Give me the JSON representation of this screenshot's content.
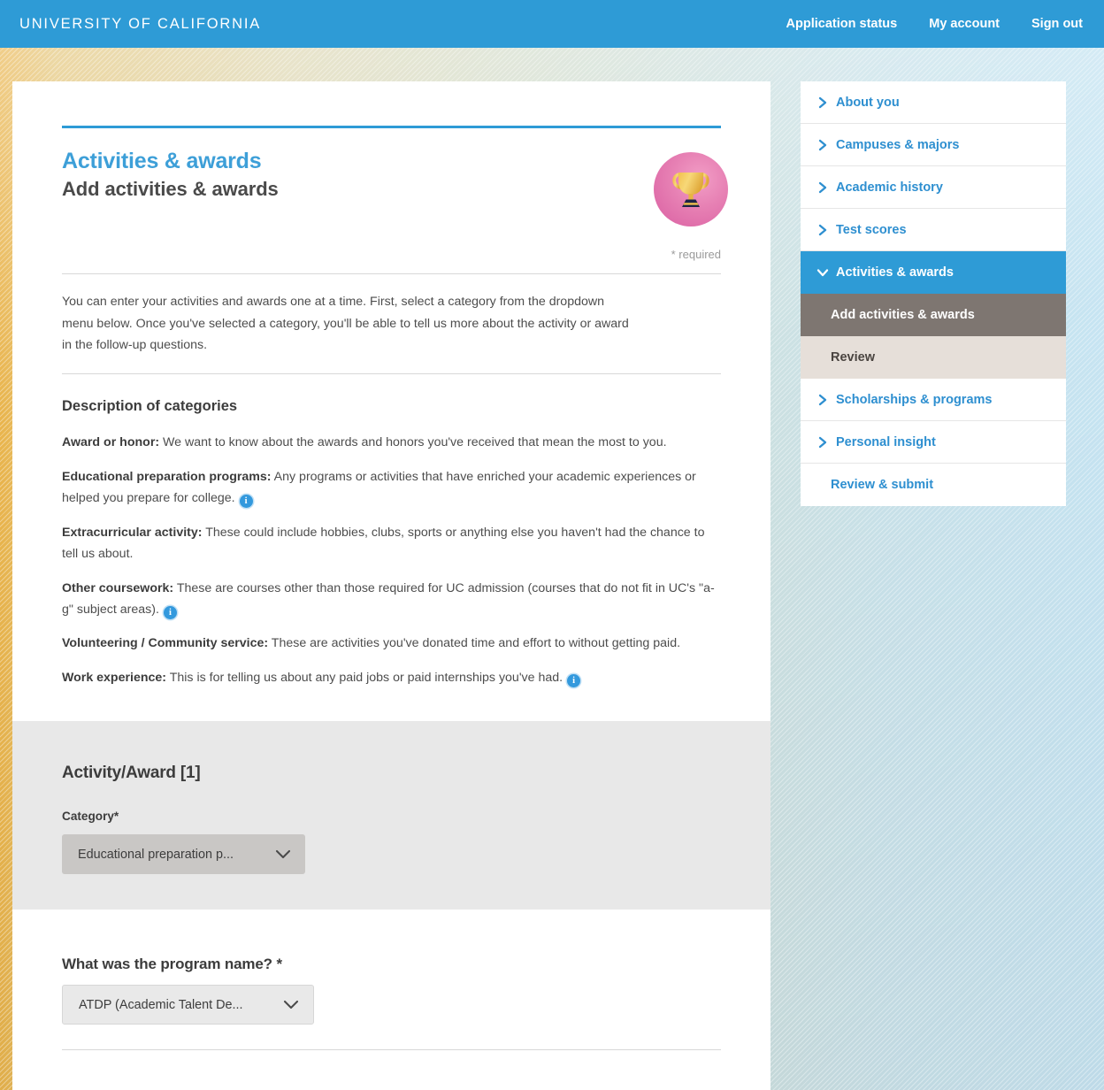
{
  "topbar": {
    "brand": "UNIVERSITY OF CALIFORNIA",
    "links": [
      {
        "label": "Application status"
      },
      {
        "label": "My account"
      },
      {
        "label": "Sign out"
      }
    ],
    "background_color": "#2e9bd6"
  },
  "header": {
    "eyebrow": "Activities & awards",
    "title": "Add activities & awards",
    "badge_icon": "trophy-icon",
    "required_note": "* required",
    "accent_color": "#3d9fd8"
  },
  "intro": {
    "text": "You can enter your activities and awards one at a time. First, select a category from the dropdown menu below. Once you've selected a category, you'll be able to tell us more about the activity or award in the follow-up questions."
  },
  "descriptions": {
    "heading": "Description of categories",
    "items": [
      {
        "term": "Award or honor:",
        "text": " We want to know about the awards and honors you've received that mean the most to you.",
        "info": false
      },
      {
        "term": "Educational preparation programs:",
        "text": " Any programs or activities that have enriched your academic experiences or helped you prepare for college.",
        "info": true
      },
      {
        "term": "Extracurricular activity:",
        "text": " These could include hobbies, clubs, sports or anything else you haven't had the chance to tell us about.",
        "info": false
      },
      {
        "term": "Other coursework:",
        "text": " These are courses other than those required for UC admission (courses that do not fit in UC's \"a-g\" subject areas).",
        "info": true
      },
      {
        "term": "Volunteering / Community service:",
        "text": " These are activities you've donated time and effort to without getting paid.",
        "info": false
      },
      {
        "term": "Work experience:",
        "text": " This is for telling us about any paid jobs or paid internships you've had.",
        "info": true
      }
    ],
    "info_glyph": "i"
  },
  "activity_panel": {
    "heading": "Activity/Award [1]",
    "category_label": "Category*",
    "category_value": "Educational preparation p...",
    "chevron_icon": "chevron-down-icon"
  },
  "program_section": {
    "question": "What was the program name? *",
    "program_value": "ATDP (Academic Talent De...",
    "chevron_icon": "chevron-down-icon"
  },
  "sidebar": {
    "items": [
      {
        "label": "About you",
        "type": "collapsed",
        "icon": "chevron-right-icon"
      },
      {
        "label": "Campuses & majors",
        "type": "collapsed",
        "icon": "chevron-right-icon"
      },
      {
        "label": "Academic history",
        "type": "collapsed",
        "icon": "chevron-right-icon"
      },
      {
        "label": "Test scores",
        "type": "collapsed",
        "icon": "chevron-right-icon"
      },
      {
        "label": "Activities & awards",
        "type": "expanded",
        "icon": "chevron-down-icon"
      },
      {
        "label": "Add activities & awards",
        "type": "sub-current"
      },
      {
        "label": "Review",
        "type": "sub-alt"
      },
      {
        "label": "Scholarships & programs",
        "type": "collapsed",
        "icon": "chevron-right-icon"
      },
      {
        "label": "Personal insight",
        "type": "collapsed",
        "icon": "chevron-right-icon"
      },
      {
        "label": "Review & submit",
        "type": "plain"
      }
    ],
    "active_color": "#2e9bd6",
    "current_sub_color": "#7e7671",
    "alt_sub_color": "#e6dfd9"
  }
}
